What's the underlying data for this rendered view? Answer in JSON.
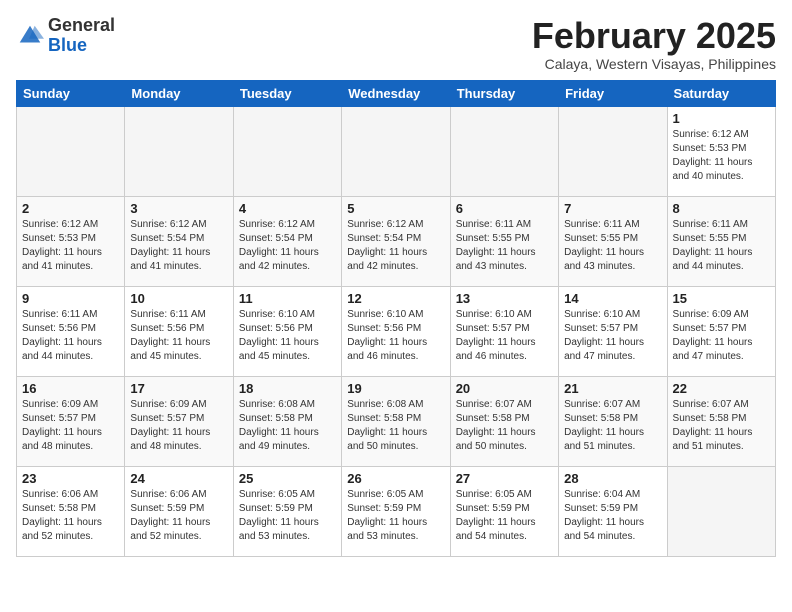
{
  "header": {
    "logo_general": "General",
    "logo_blue": "Blue",
    "month_title": "February 2025",
    "subtitle": "Calaya, Western Visayas, Philippines"
  },
  "days_of_week": [
    "Sunday",
    "Monday",
    "Tuesday",
    "Wednesday",
    "Thursday",
    "Friday",
    "Saturday"
  ],
  "weeks": [
    [
      {
        "day": "",
        "empty": true
      },
      {
        "day": "",
        "empty": true
      },
      {
        "day": "",
        "empty": true
      },
      {
        "day": "",
        "empty": true
      },
      {
        "day": "",
        "empty": true
      },
      {
        "day": "",
        "empty": true
      },
      {
        "day": "1",
        "sunrise": "6:12 AM",
        "sunset": "5:53 PM",
        "daylight": "11 hours and 40 minutes."
      }
    ],
    [
      {
        "day": "2",
        "sunrise": "6:12 AM",
        "sunset": "5:53 PM",
        "daylight": "11 hours and 41 minutes."
      },
      {
        "day": "3",
        "sunrise": "6:12 AM",
        "sunset": "5:54 PM",
        "daylight": "11 hours and 41 minutes."
      },
      {
        "day": "4",
        "sunrise": "6:12 AM",
        "sunset": "5:54 PM",
        "daylight": "11 hours and 42 minutes."
      },
      {
        "day": "5",
        "sunrise": "6:12 AM",
        "sunset": "5:54 PM",
        "daylight": "11 hours and 42 minutes."
      },
      {
        "day": "6",
        "sunrise": "6:11 AM",
        "sunset": "5:55 PM",
        "daylight": "11 hours and 43 minutes."
      },
      {
        "day": "7",
        "sunrise": "6:11 AM",
        "sunset": "5:55 PM",
        "daylight": "11 hours and 43 minutes."
      },
      {
        "day": "8",
        "sunrise": "6:11 AM",
        "sunset": "5:55 PM",
        "daylight": "11 hours and 44 minutes."
      }
    ],
    [
      {
        "day": "9",
        "sunrise": "6:11 AM",
        "sunset": "5:56 PM",
        "daylight": "11 hours and 44 minutes."
      },
      {
        "day": "10",
        "sunrise": "6:11 AM",
        "sunset": "5:56 PM",
        "daylight": "11 hours and 45 minutes."
      },
      {
        "day": "11",
        "sunrise": "6:10 AM",
        "sunset": "5:56 PM",
        "daylight": "11 hours and 45 minutes."
      },
      {
        "day": "12",
        "sunrise": "6:10 AM",
        "sunset": "5:56 PM",
        "daylight": "11 hours and 46 minutes."
      },
      {
        "day": "13",
        "sunrise": "6:10 AM",
        "sunset": "5:57 PM",
        "daylight": "11 hours and 46 minutes."
      },
      {
        "day": "14",
        "sunrise": "6:10 AM",
        "sunset": "5:57 PM",
        "daylight": "11 hours and 47 minutes."
      },
      {
        "day": "15",
        "sunrise": "6:09 AM",
        "sunset": "5:57 PM",
        "daylight": "11 hours and 47 minutes."
      }
    ],
    [
      {
        "day": "16",
        "sunrise": "6:09 AM",
        "sunset": "5:57 PM",
        "daylight": "11 hours and 48 minutes."
      },
      {
        "day": "17",
        "sunrise": "6:09 AM",
        "sunset": "5:57 PM",
        "daylight": "11 hours and 48 minutes."
      },
      {
        "day": "18",
        "sunrise": "6:08 AM",
        "sunset": "5:58 PM",
        "daylight": "11 hours and 49 minutes."
      },
      {
        "day": "19",
        "sunrise": "6:08 AM",
        "sunset": "5:58 PM",
        "daylight": "11 hours and 50 minutes."
      },
      {
        "day": "20",
        "sunrise": "6:07 AM",
        "sunset": "5:58 PM",
        "daylight": "11 hours and 50 minutes."
      },
      {
        "day": "21",
        "sunrise": "6:07 AM",
        "sunset": "5:58 PM",
        "daylight": "11 hours and 51 minutes."
      },
      {
        "day": "22",
        "sunrise": "6:07 AM",
        "sunset": "5:58 PM",
        "daylight": "11 hours and 51 minutes."
      }
    ],
    [
      {
        "day": "23",
        "sunrise": "6:06 AM",
        "sunset": "5:58 PM",
        "daylight": "11 hours and 52 minutes."
      },
      {
        "day": "24",
        "sunrise": "6:06 AM",
        "sunset": "5:59 PM",
        "daylight": "11 hours and 52 minutes."
      },
      {
        "day": "25",
        "sunrise": "6:05 AM",
        "sunset": "5:59 PM",
        "daylight": "11 hours and 53 minutes."
      },
      {
        "day": "26",
        "sunrise": "6:05 AM",
        "sunset": "5:59 PM",
        "daylight": "11 hours and 53 minutes."
      },
      {
        "day": "27",
        "sunrise": "6:05 AM",
        "sunset": "5:59 PM",
        "daylight": "11 hours and 54 minutes."
      },
      {
        "day": "28",
        "sunrise": "6:04 AM",
        "sunset": "5:59 PM",
        "daylight": "11 hours and 54 minutes."
      },
      {
        "day": "",
        "empty": true
      }
    ]
  ]
}
